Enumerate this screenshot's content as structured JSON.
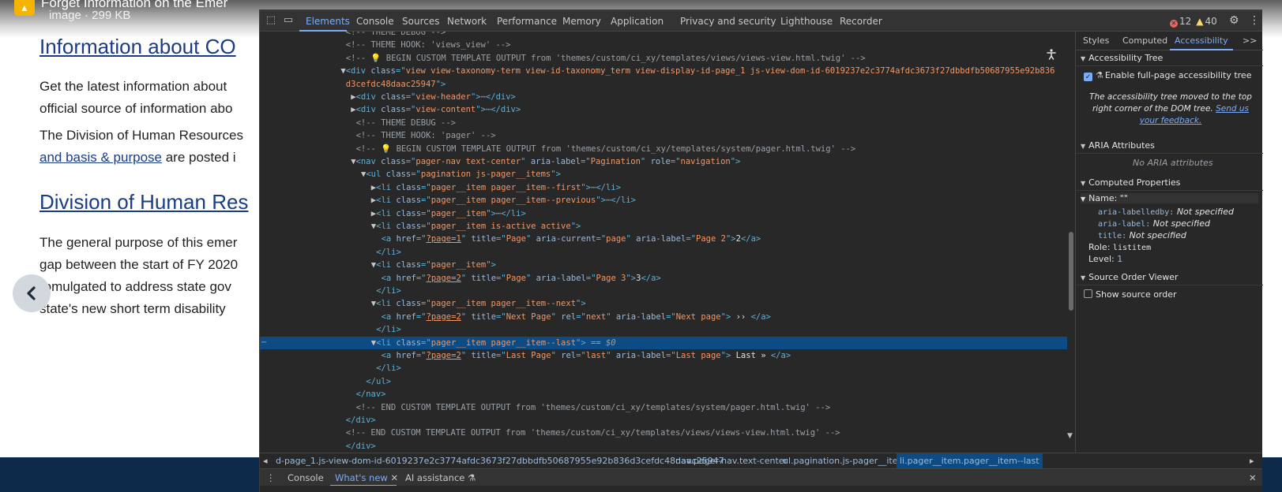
{
  "bg_page": {
    "download": {
      "title": "Forget Information on the Emer",
      "subtitle": "image · 299 KB"
    },
    "heading1": "Information about CO",
    "para1_line1": "Get the latest information about",
    "para1_line2": "official source of information abo",
    "para2_line1": "The Division of Human Resources",
    "para2_link": "and basis & purpose",
    "para2_line2_rest": " are posted i",
    "heading2": "Division of Human Res",
    "para3_line1": "The general purpose of this emer",
    "para3_line2": "gap between the start of FY 2020",
    "para3_line3": "romulgated to address state gov",
    "para3_line4": "state's new short term disability"
  },
  "devtools": {
    "tabs": [
      "Elements",
      "Console",
      "Sources",
      "Network",
      "Performance",
      "Memory",
      "Application",
      "Privacy and security",
      "Lighthouse",
      "Recorder"
    ],
    "active_tab": "Elements",
    "error_count": "12",
    "warning_count": "40",
    "side_tabs": [
      "Styles",
      "Computed",
      "Accessibility"
    ],
    "side_active": "Accessibility",
    "side_more": ">>",
    "accessibility": {
      "tree_header": "Accessibility Tree",
      "enable_label": "Enable full-page accessibility tree",
      "note": "The accessibility tree moved to the top right corner of the DOM tree.",
      "note_link": "Send us your feedback.",
      "aria_header": "ARIA Attributes",
      "no_aria": "No ARIA attributes",
      "computed_header": "Computed Properties",
      "name_row": "Name: \"\"",
      "labelledby_key": "aria-labelledby:",
      "labelledby_val": "Not specified",
      "label_key": "aria-label:",
      "label_val": "Not specified",
      "title_key": "title:",
      "title_val": "Not specified",
      "role_key": "Role:",
      "role_val": "listitem",
      "level_key": "Level:",
      "level_val": "1",
      "source_order_header": "Source Order Viewer",
      "show_source_order": "Show source order"
    },
    "breadcrumbs": [
      "d-page_1.js-view-dom-id-6019237e2c3774afdc3673f27dbbdfb50687955e92b836d3cefdc48daac25947",
      "nav.pager-nav.text-center",
      "ul.pagination.js-pager__items",
      "li.pager__item.pager__item--last"
    ],
    "drawer_tabs": [
      "Console",
      "What's new",
      "AI assistance"
    ],
    "drawer_active": "What's new",
    "code_lines": [
      {
        "indent": 12,
        "parts": [
          [
            "c",
            "<!-- THEME DEBUG -->"
          ]
        ]
      },
      {
        "indent": 12,
        "parts": [
          [
            "c",
            "<!-- THEME HOOK: 'views_view' -->"
          ]
        ]
      },
      {
        "indent": 12,
        "parts": [
          [
            "c",
            "<!-- "
          ],
          [
            "bulb",
            "💡"
          ],
          [
            "c",
            " BEGIN CUSTOM TEMPLATE OUTPUT from 'themes/custom/ci_xy/templates/views/views-view.html.twig' -->"
          ]
        ]
      },
      {
        "indent": 11,
        "parts": [
          [
            "tri",
            "▼"
          ],
          [
            "t",
            "<div "
          ],
          [
            "an",
            "class"
          ],
          [
            "t",
            "=\""
          ],
          [
            "av",
            "view view-taxonomy-term view-id-taxonomy_term view-display-id-page_1 js-view-dom-id-6019237e2c3774afdc3673f27dbbdfb50687955e92b836"
          ],
          [
            "t",
            ""
          ]
        ]
      },
      {
        "indent": 12,
        "parts": [
          [
            "av",
            "d3cefdc48daac25947"
          ],
          [
            "t",
            "\">"
          ]
        ]
      },
      {
        "indent": 13,
        "parts": [
          [
            "tri",
            "▶"
          ],
          [
            "t",
            "<div "
          ],
          [
            "an",
            "class"
          ],
          [
            "t",
            "=\""
          ],
          [
            "av",
            "view-header"
          ],
          [
            "t",
            "\">"
          ],
          [
            "sel",
            "⋯"
          ],
          [
            "t",
            "</div>"
          ]
        ]
      },
      {
        "indent": 13,
        "parts": [
          [
            "tri",
            "▶"
          ],
          [
            "t",
            "<div "
          ],
          [
            "an",
            "class"
          ],
          [
            "t",
            "=\""
          ],
          [
            "av",
            "view-content"
          ],
          [
            "t",
            "\">"
          ],
          [
            "sel",
            "⋯"
          ],
          [
            "t",
            "</div>"
          ]
        ]
      },
      {
        "indent": 14,
        "parts": [
          [
            "c",
            "<!-- THEME DEBUG -->"
          ]
        ]
      },
      {
        "indent": 14,
        "parts": [
          [
            "c",
            "<!-- THEME HOOK: 'pager' -->"
          ]
        ]
      },
      {
        "indent": 14,
        "parts": [
          [
            "c",
            "<!-- "
          ],
          [
            "bulb",
            "💡"
          ],
          [
            "c",
            " BEGIN CUSTOM TEMPLATE OUTPUT from 'themes/custom/ci_xy/templates/system/pager.html.twig' -->"
          ]
        ]
      },
      {
        "indent": 13,
        "parts": [
          [
            "tri",
            "▼"
          ],
          [
            "t",
            "<nav "
          ],
          [
            "an",
            "class"
          ],
          [
            "t",
            "=\""
          ],
          [
            "av",
            "pager-nav text-center"
          ],
          [
            "t",
            "\" "
          ],
          [
            "an",
            "aria-label"
          ],
          [
            "t",
            "=\""
          ],
          [
            "av",
            "Pagination"
          ],
          [
            "t",
            "\" "
          ],
          [
            "an",
            "role"
          ],
          [
            "t",
            "=\""
          ],
          [
            "av",
            "navigation"
          ],
          [
            "t",
            "\">"
          ]
        ]
      },
      {
        "indent": 15,
        "parts": [
          [
            "tri",
            "▼"
          ],
          [
            "t",
            "<ul "
          ],
          [
            "an",
            "class"
          ],
          [
            "t",
            "=\""
          ],
          [
            "av",
            "pagination js-pager__items"
          ],
          [
            "t",
            "\">"
          ]
        ]
      },
      {
        "indent": 17,
        "parts": [
          [
            "tri",
            "▶"
          ],
          [
            "t",
            "<li "
          ],
          [
            "an",
            "class"
          ],
          [
            "t",
            "=\""
          ],
          [
            "av",
            "pager__item pager__item--first"
          ],
          [
            "t",
            "\">"
          ],
          [
            "sel",
            "⋯"
          ],
          [
            "t",
            "</li>"
          ]
        ]
      },
      {
        "indent": 17,
        "parts": [
          [
            "tri",
            "▶"
          ],
          [
            "t",
            "<li "
          ],
          [
            "an",
            "class"
          ],
          [
            "t",
            "=\""
          ],
          [
            "av",
            "pager__item pager__item--previous"
          ],
          [
            "t",
            "\">"
          ],
          [
            "sel",
            "⋯"
          ],
          [
            "t",
            "</li>"
          ]
        ]
      },
      {
        "indent": 17,
        "parts": [
          [
            "tri",
            "▶"
          ],
          [
            "t",
            "<li "
          ],
          [
            "an",
            "class"
          ],
          [
            "t",
            "=\""
          ],
          [
            "av",
            "pager__item"
          ],
          [
            "t",
            "\">"
          ],
          [
            "sel",
            "⋯"
          ],
          [
            "t",
            "</li>"
          ]
        ]
      },
      {
        "indent": 17,
        "parts": [
          [
            "tri",
            "▼"
          ],
          [
            "t",
            "<li "
          ],
          [
            "an",
            "class"
          ],
          [
            "t",
            "=\""
          ],
          [
            "av",
            "pager__item is-active active"
          ],
          [
            "t",
            "\">"
          ]
        ]
      },
      {
        "indent": 19,
        "parts": [
          [
            "t",
            "<a "
          ],
          [
            "an",
            "href"
          ],
          [
            "t",
            "=\""
          ],
          [
            "ln",
            "?page=1"
          ],
          [
            "t",
            "\" "
          ],
          [
            "an",
            "title"
          ],
          [
            "t",
            "=\""
          ],
          [
            "av",
            "Page"
          ],
          [
            "t",
            "\" "
          ],
          [
            "an",
            "aria-current"
          ],
          [
            "t",
            "=\""
          ],
          [
            "av",
            "page"
          ],
          [
            "t",
            "\" "
          ],
          [
            "an",
            "aria-label"
          ],
          [
            "t",
            "=\""
          ],
          [
            "av",
            "Page 2"
          ],
          [
            "t",
            "\">"
          ],
          [
            "tx",
            "2"
          ],
          [
            "t",
            "</a>"
          ]
        ]
      },
      {
        "indent": 18,
        "parts": [
          [
            "t",
            "</li>"
          ]
        ]
      },
      {
        "indent": 17,
        "parts": [
          [
            "tri",
            "▼"
          ],
          [
            "t",
            "<li "
          ],
          [
            "an",
            "class"
          ],
          [
            "t",
            "=\""
          ],
          [
            "av",
            "pager__item"
          ],
          [
            "t",
            "\">"
          ]
        ]
      },
      {
        "indent": 19,
        "parts": [
          [
            "t",
            "<a "
          ],
          [
            "an",
            "href"
          ],
          [
            "t",
            "=\""
          ],
          [
            "ln",
            "?page=2"
          ],
          [
            "t",
            "\" "
          ],
          [
            "an",
            "title"
          ],
          [
            "t",
            "=\""
          ],
          [
            "av",
            "Page"
          ],
          [
            "t",
            "\" "
          ],
          [
            "an",
            "aria-label"
          ],
          [
            "t",
            "=\""
          ],
          [
            "av",
            "Page 3"
          ],
          [
            "t",
            "\">"
          ],
          [
            "tx",
            "3"
          ],
          [
            "t",
            "</a>"
          ]
        ]
      },
      {
        "indent": 18,
        "parts": [
          [
            "t",
            "</li>"
          ]
        ]
      },
      {
        "indent": 17,
        "parts": [
          [
            "tri",
            "▼"
          ],
          [
            "t",
            "<li "
          ],
          [
            "an",
            "class"
          ],
          [
            "t",
            "=\""
          ],
          [
            "av",
            "pager__item pager__item--next"
          ],
          [
            "t",
            "\">"
          ]
        ]
      },
      {
        "indent": 19,
        "parts": [
          [
            "t",
            "<a "
          ],
          [
            "an",
            "href"
          ],
          [
            "t",
            "=\""
          ],
          [
            "ln",
            "?page=2"
          ],
          [
            "t",
            "\" "
          ],
          [
            "an",
            "title"
          ],
          [
            "t",
            "=\""
          ],
          [
            "av",
            "Next Page"
          ],
          [
            "t",
            "\" "
          ],
          [
            "an",
            "rel"
          ],
          [
            "t",
            "=\""
          ],
          [
            "av",
            "next"
          ],
          [
            "t",
            "\" "
          ],
          [
            "an",
            "aria-label"
          ],
          [
            "t",
            "=\""
          ],
          [
            "av",
            "Next page"
          ],
          [
            "t",
            "\">"
          ],
          [
            "tx",
            " ›› "
          ],
          [
            "t",
            "</a>"
          ]
        ]
      },
      {
        "indent": 18,
        "parts": [
          [
            "t",
            "</li>"
          ]
        ]
      },
      {
        "indent": 17,
        "selected": true,
        "parts": [
          [
            "tri",
            "▼"
          ],
          [
            "t",
            "<li "
          ],
          [
            "an",
            "class"
          ],
          [
            "t",
            "=\""
          ],
          [
            "av",
            "pager__item pager__item--last"
          ],
          [
            "t",
            "\">"
          ],
          [
            "sel",
            " == $0"
          ]
        ]
      },
      {
        "indent": 19,
        "parts": [
          [
            "t",
            "<a "
          ],
          [
            "an",
            "href"
          ],
          [
            "t",
            "=\""
          ],
          [
            "ln",
            "?page=2"
          ],
          [
            "t",
            "\" "
          ],
          [
            "an",
            "title"
          ],
          [
            "t",
            "=\""
          ],
          [
            "av",
            "Last Page"
          ],
          [
            "t",
            "\" "
          ],
          [
            "an",
            "rel"
          ],
          [
            "t",
            "=\""
          ],
          [
            "av",
            "last"
          ],
          [
            "t",
            "\" "
          ],
          [
            "an",
            "aria-label"
          ],
          [
            "t",
            "=\""
          ],
          [
            "av",
            "Last page"
          ],
          [
            "t",
            "\">"
          ],
          [
            "tx",
            " Last » "
          ],
          [
            "t",
            "</a>"
          ]
        ]
      },
      {
        "indent": 18,
        "parts": [
          [
            "t",
            "</li>"
          ]
        ]
      },
      {
        "indent": 16,
        "parts": [
          [
            "t",
            "</ul>"
          ]
        ]
      },
      {
        "indent": 14,
        "parts": [
          [
            "t",
            "</nav>"
          ]
        ]
      },
      {
        "indent": 14,
        "parts": [
          [
            "c",
            "<!-- END CUSTOM TEMPLATE OUTPUT from 'themes/custom/ci_xy/templates/system/pager.html.twig' -->"
          ]
        ]
      },
      {
        "indent": 12,
        "parts": [
          [
            "t",
            "</div>"
          ]
        ]
      },
      {
        "indent": 12,
        "parts": [
          [
            "c",
            "<!-- END CUSTOM TEMPLATE OUTPUT from 'themes/custom/ci_xy/templates/views/views-view.html.twig' -->"
          ]
        ]
      },
      {
        "indent": 12,
        "parts": [
          [
            "t",
            "</div>"
          ]
        ]
      }
    ]
  }
}
